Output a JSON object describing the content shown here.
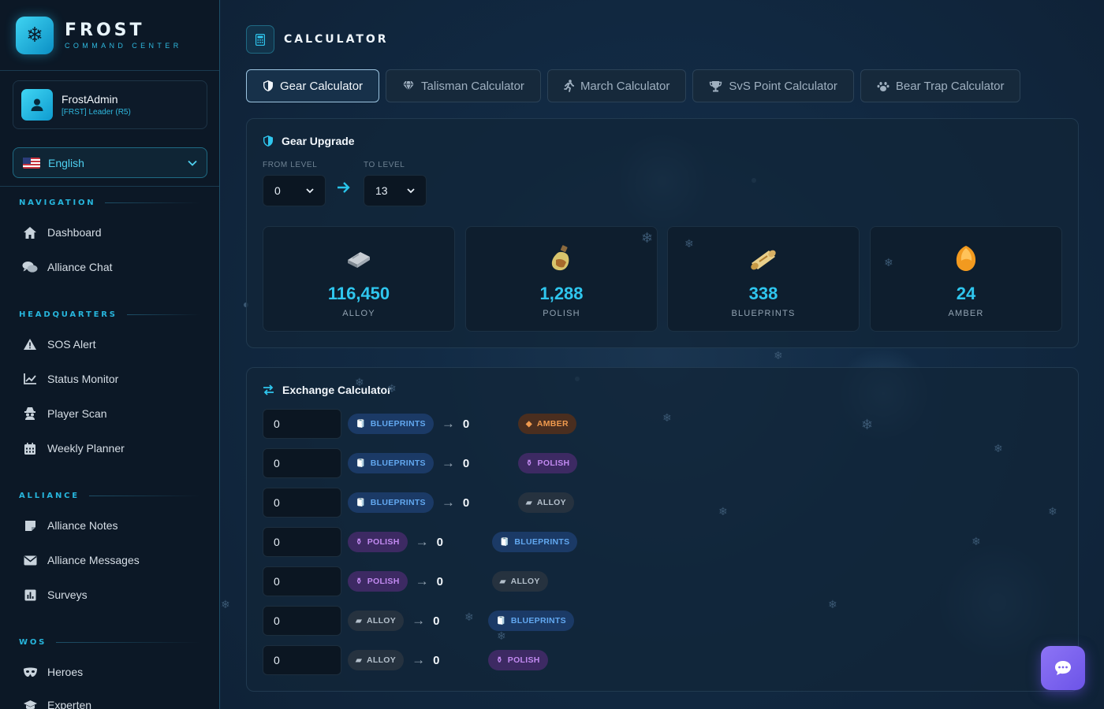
{
  "brand": {
    "name": "FROST",
    "subtitle": "COMMAND CENTER"
  },
  "user": {
    "name": "FrostAdmin",
    "role": "[FRST]  Leader (R5)"
  },
  "language": {
    "selected": "English",
    "flag": "us-flag"
  },
  "nav": {
    "sections": [
      {
        "title": "NAVIGATION",
        "items": [
          {
            "label": "Dashboard",
            "icon": "home-icon"
          },
          {
            "label": "Alliance Chat",
            "icon": "chat-icon"
          }
        ]
      },
      {
        "title": "HEADQUARTERS",
        "items": [
          {
            "label": "SOS Alert",
            "icon": "warning-icon"
          },
          {
            "label": "Status Monitor",
            "icon": "chart-line-icon"
          },
          {
            "label": "Player Scan",
            "icon": "spy-icon"
          },
          {
            "label": "Weekly Planner",
            "icon": "calendar-icon"
          }
        ]
      },
      {
        "title": "ALLIANCE",
        "items": [
          {
            "label": "Alliance Notes",
            "icon": "note-icon"
          },
          {
            "label": "Alliance Messages",
            "icon": "envelope-icon"
          },
          {
            "label": "Surveys",
            "icon": "poll-icon"
          }
        ]
      },
      {
        "title": "WOS",
        "items": [
          {
            "label": "Heroes",
            "icon": "mask-icon"
          },
          {
            "label": "Experten",
            "icon": "graduation-cap-icon"
          }
        ]
      }
    ]
  },
  "page": {
    "title": "CALCULATOR",
    "icon": "calculator-icon"
  },
  "tabs": [
    {
      "label": "Gear Calculator",
      "icon": "shield-icon",
      "active": true
    },
    {
      "label": "Talisman Calculator",
      "icon": "gem-icon",
      "active": false
    },
    {
      "label": "March Calculator",
      "icon": "running-icon",
      "active": false
    },
    {
      "label": "SvS Point Calculator",
      "icon": "trophy-icon",
      "active": false
    },
    {
      "label": "Bear Trap Calculator",
      "icon": "paw-icon",
      "active": false
    }
  ],
  "gear": {
    "title": "Gear Upgrade",
    "from_label": "FROM LEVEL",
    "to_label": "TO LEVEL",
    "from_value": "0",
    "to_value": "13",
    "resources": [
      {
        "value": "116,450",
        "name": "ALLOY",
        "icon": "alloy-bar-icon"
      },
      {
        "value": "1,288",
        "name": "POLISH",
        "icon": "polish-bottle-icon"
      },
      {
        "value": "338",
        "name": "BLUEPRINTS",
        "icon": "blueprint-scroll-icon"
      },
      {
        "value": "24",
        "name": "AMBER",
        "icon": "amber-gem-icon"
      }
    ]
  },
  "exchange": {
    "title": "Exchange Calculator",
    "rows": [
      {
        "input": "0",
        "from": "BLUEPRINTS",
        "output": "0",
        "to": "AMBER"
      },
      {
        "input": "0",
        "from": "BLUEPRINTS",
        "output": "0",
        "to": "POLISH"
      },
      {
        "input": "0",
        "from": "BLUEPRINTS",
        "output": "0",
        "to": "ALLOY"
      },
      {
        "input": "0",
        "from": "POLISH",
        "output": "0",
        "to": "BLUEPRINTS"
      },
      {
        "input": "0",
        "from": "POLISH",
        "output": "0",
        "to": "ALLOY"
      },
      {
        "input": "0",
        "from": "ALLOY",
        "output": "0",
        "to": "BLUEPRINTS"
      },
      {
        "input": "0",
        "from": "ALLOY",
        "output": "0",
        "to": "POLISH"
      }
    ]
  },
  "colors": {
    "accent": "#2fc6ee",
    "blueprints": "#62a8f0",
    "polish": "#c28af1",
    "alloy": "#b3bfcb",
    "amber": "#f09a4e",
    "chat": "#7b63ef"
  }
}
